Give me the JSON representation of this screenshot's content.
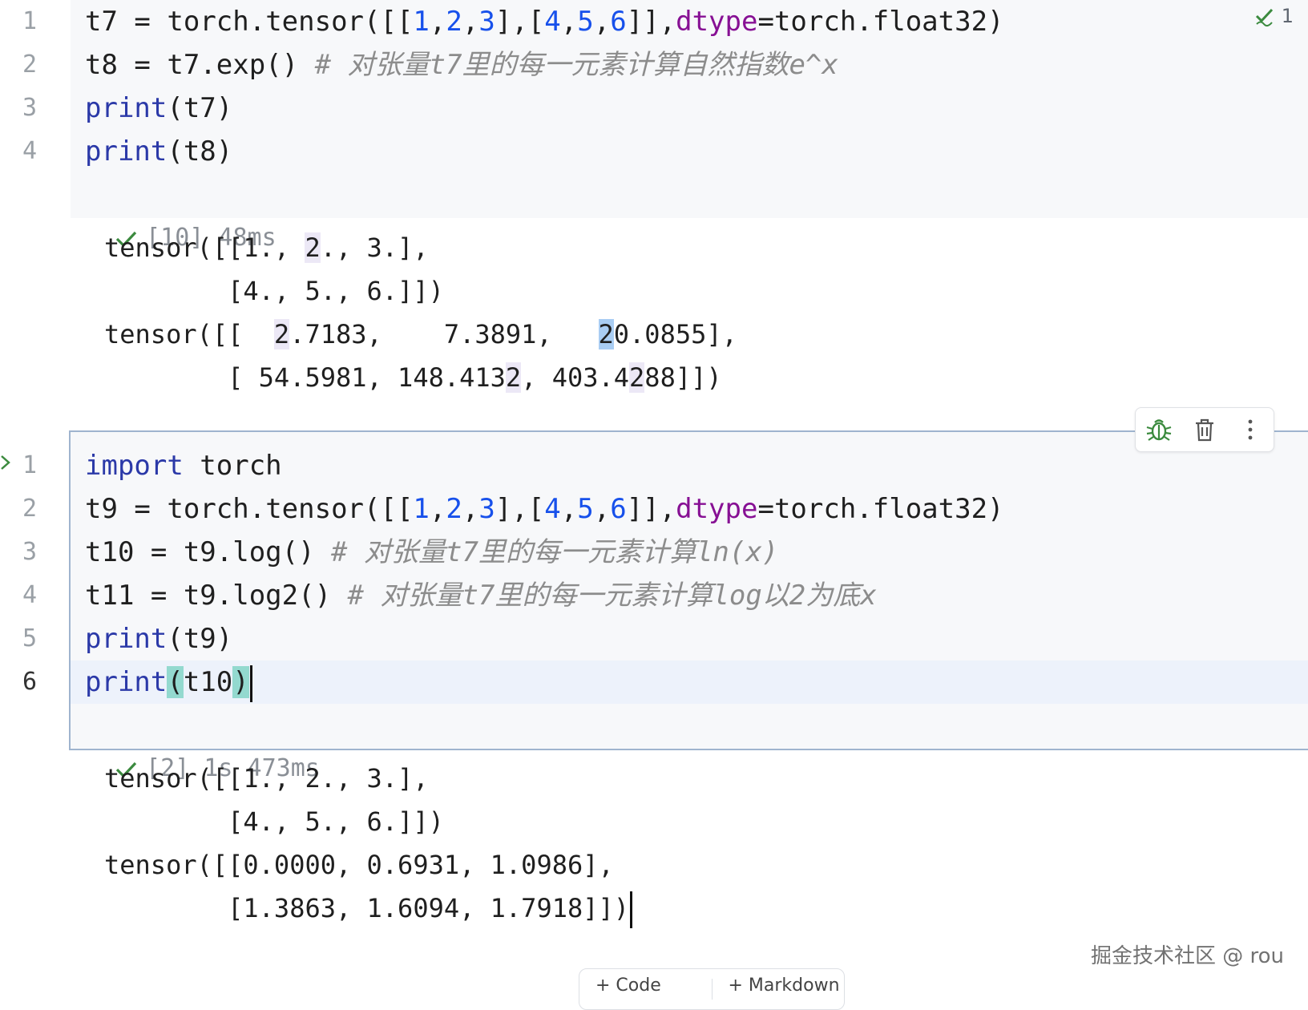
{
  "inspection": {
    "count": "1"
  },
  "cell1": {
    "line_numbers": [
      "1",
      "2",
      "3",
      "4"
    ],
    "lines": {
      "l1": {
        "var": "t7",
        "eq": " = ",
        "call": "torch.tensor([[",
        "n1": "1",
        "c1": ",",
        "n2": "2",
        "c2": ",",
        "n3": "3",
        "mid": "],[",
        "n4": "4",
        "c3": ",",
        "n5": "5",
        "c4": ",",
        "n6": "6",
        "close": "]],",
        "param": "dtype",
        "rest": "=torch.float32)"
      },
      "l2": {
        "code": "t8 = t7.exp() ",
        "comment": "# 对张量t7里的每一元素计算自然指数e^x"
      },
      "l3": {
        "kw": "print",
        "rest": "(t7)"
      },
      "l4": {
        "kw": "print",
        "rest": "(t8)"
      }
    },
    "status": "[10] 48ms",
    "output": {
      "o1a": "tensor([[1., ",
      "o1b": "2",
      "o1c": "., 3.],",
      "o2": "        [4., 5., 6.]])",
      "o3a": "tensor([[  ",
      "o3b": "2",
      "o3c": ".7183,    7.3891,   ",
      "o3d": "2",
      "o3e": "0.0855],",
      "o4a": "        [ 54.5981, 148.413",
      "o4b": "2",
      "o4c": ", 403.4",
      "o4d": "2",
      "o4e": "88]])"
    }
  },
  "cell2": {
    "line_numbers": [
      "1",
      "2",
      "3",
      "4",
      "5",
      "6"
    ],
    "lines": {
      "l1": {
        "kw": "import",
        "rest": " torch"
      },
      "l2": {
        "var": "t9",
        "eq": " = ",
        "call": "torch.tensor([[",
        "n1": "1",
        "c1": ",",
        "n2": "2",
        "c2": ",",
        "n3": "3",
        "mid": "],[",
        "n4": "4",
        "c3": ",",
        "n5": "5",
        "c4": ",",
        "n6": "6",
        "close": "]],",
        "param": "dtype",
        "rest": "=torch.float32)"
      },
      "l3": {
        "code": "t10 = t9.log() ",
        "comment": "# 对张量t7里的每一元素计算ln(x)"
      },
      "l4": {
        "code": "t11 = t9.log2() ",
        "comment": "# 对张量t7里的每一元素计算log以2为底x"
      },
      "l5": {
        "kw": "print",
        "rest": "(t9)"
      },
      "l6": {
        "kw": "print",
        "open": "(",
        "arg": "t10",
        "close": ")"
      }
    },
    "status": "[2] 1s 473ms",
    "output": {
      "o1": "tensor([[1., 2., 3.],",
      "o2": "        [4., 5., 6.]])",
      "o3": "tensor([[0.0000, 0.6931, 1.0986],",
      "o4": "        [1.3863, 1.6094, 1.7918]])"
    }
  },
  "toolbar": {
    "debug_icon": "bug-icon",
    "delete_icon": "trash-icon",
    "more_icon": "vertical-dots-icon"
  },
  "add_cell_bar": {
    "code_label": "+ Code",
    "markdown_label": "+ Markdown"
  },
  "watermark": "掘金技术社区 @ rou",
  "colors": {
    "keyword": "#2b39a8",
    "number": "#1750eb",
    "param": "#871094",
    "comment": "#8c8c8c",
    "success": "#3b8a3e"
  }
}
